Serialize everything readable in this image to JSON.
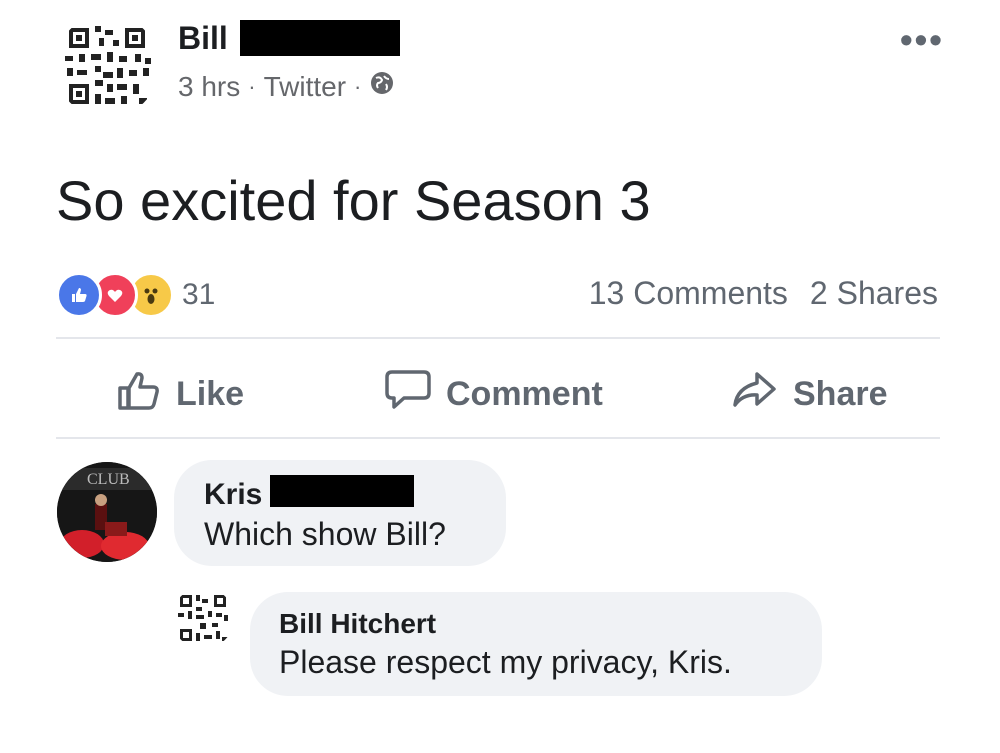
{
  "post": {
    "author": "Bill",
    "time": "3 hrs",
    "source": "Twitter",
    "separator": "·",
    "audience_icon": "globe-icon",
    "more_icon": "more-options-icon",
    "text": "So excited for Season 3",
    "reactions": {
      "icons": [
        "like-reaction-icon",
        "love-reaction-icon",
        "wow-reaction-icon"
      ],
      "count": "31"
    },
    "comments_count": "13 Comments",
    "shares_count": "2 Shares"
  },
  "actions": {
    "like": "Like",
    "comment": "Comment",
    "share": "Share"
  },
  "comments": [
    {
      "name": "Kris",
      "text": "Which show Bill?",
      "avatar_text": "CLUB"
    },
    {
      "name": "Bill Hitchert",
      "text": "Please respect my privacy, Kris."
    }
  ],
  "colors": {
    "like_blue": "#4a77e8",
    "love_red": "#f0405a",
    "wow_yellow": "#f7c948",
    "muted_text": "#606770",
    "bubble_bg": "#f0f2f5"
  }
}
